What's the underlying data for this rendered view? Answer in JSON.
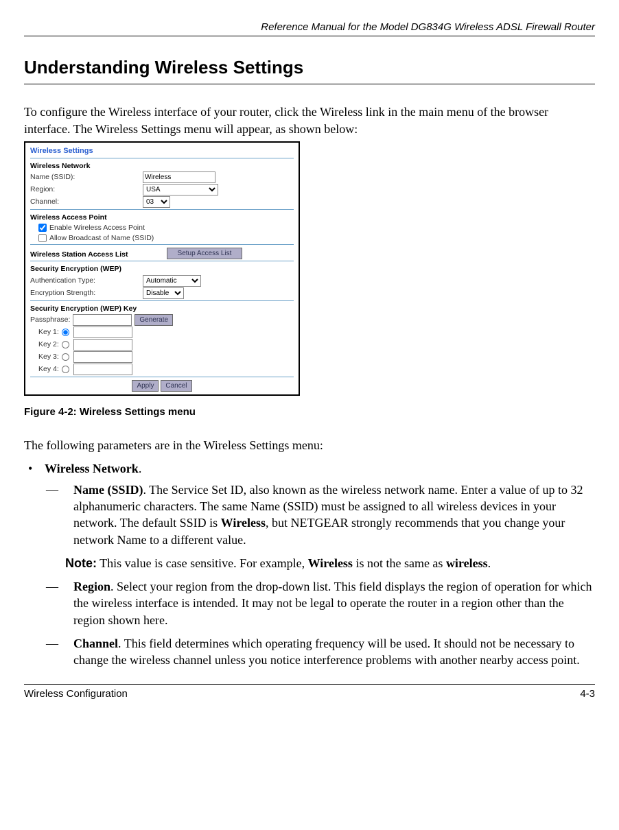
{
  "header": "Reference Manual for the Model DG834G Wireless ADSL Firewall Router",
  "title": "Understanding Wireless Settings",
  "intro": "To configure the Wireless interface of your router, click the Wireless link in the main menu of the browser interface. The Wireless Settings menu will appear, as shown below:",
  "fig": {
    "title": "Wireless Settings",
    "net_head": "Wireless Network",
    "name_lbl": "Name (SSID):",
    "name_val": "Wireless",
    "region_lbl": "Region:",
    "region_val": "USA",
    "channel_lbl": "Channel:",
    "channel_val": "03",
    "ap_head": "Wireless Access Point",
    "ap_enable": "Enable Wireless Access Point",
    "ap_broadcast": "Allow Broadcast of Name (SSID)",
    "acl_head": "Wireless Station Access List",
    "acl_btn": "Setup Access List",
    "wep_head": "Security Encryption (WEP)",
    "auth_lbl": "Authentication Type:",
    "auth_val": "Automatic",
    "enc_lbl": "Encryption Strength:",
    "enc_val": "Disable",
    "wepkey_head": "Security Encryption (WEP) Key",
    "pass_lbl": "Passphrase:",
    "gen_btn": "Generate",
    "key1": "Key 1:",
    "key2": "Key 2:",
    "key3": "Key 3:",
    "key4": "Key 4:",
    "apply": "Apply",
    "cancel": "Cancel"
  },
  "caption": "Figure 4-2:  Wireless Settings menu",
  "params_intro": "The following parameters are in the Wireless Settings menu:",
  "bullet_head": "Wireless Network",
  "name_bold": "Name (SSID)",
  "name_text": ". The Service Set ID, also known as the wireless network name. Enter a value of up to 32 alphanumeric characters. The same Name (SSID) must be assigned to all wireless devices in your network. The default SSID is ",
  "name_default": "Wireless",
  "name_text2": ", but NETGEAR strongly recommends that you change your network Name to a different value.",
  "note_label": "Note:",
  "note_text": " This value is case sensitive. For example, ",
  "note_w1": "Wireless",
  "note_mid": " is not the same as ",
  "note_w2": "wireless",
  "region_bold": "Region",
  "region_text": ". Select your region from the drop-down list. This field displays the region of operation for which the wireless interface is intended. It may not be legal to operate the router in a region other than the region shown here.",
  "channel_bold": "Channel",
  "channel_text": ". This field determines which operating frequency will be used. It should not be necessary to change the wireless channel unless you notice interference problems with another nearby access point.",
  "footer_left": "Wireless Configuration",
  "footer_right": "4-3"
}
